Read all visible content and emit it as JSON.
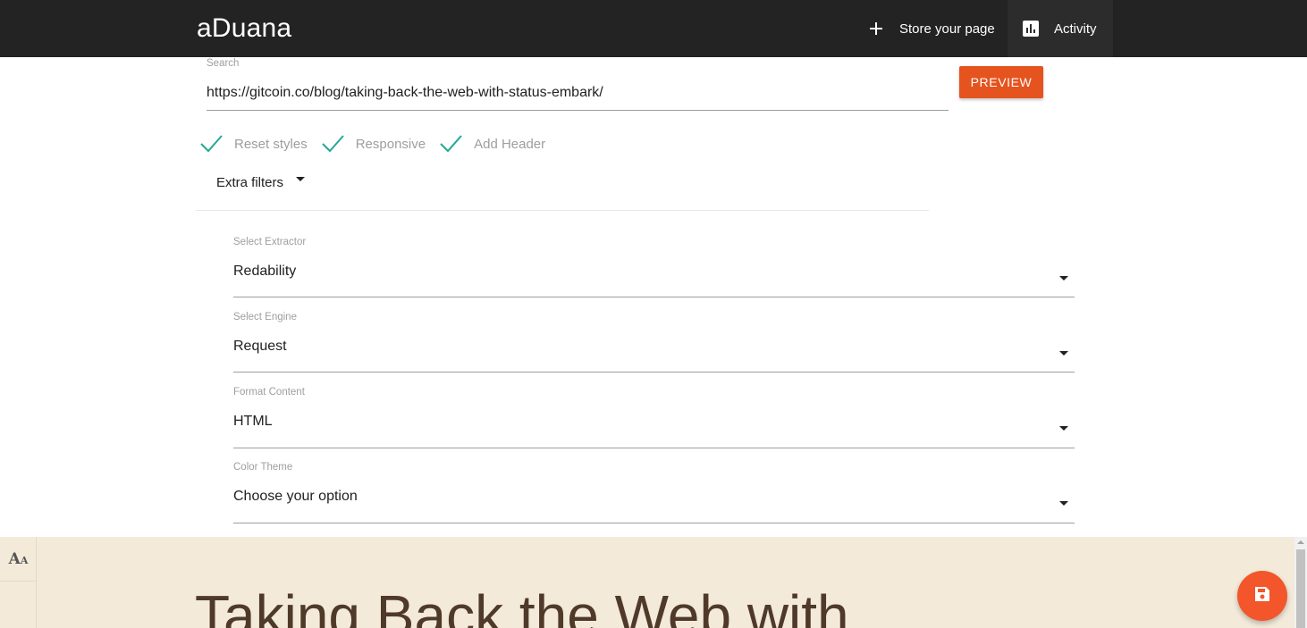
{
  "nav": {
    "brand": "aDuana",
    "store_label": "Store your page",
    "activity_label": "Activity",
    "store_icon": "plus-icon",
    "activity_icon": "bar-chart-icon",
    "background": "#232323"
  },
  "search": {
    "label": "Search",
    "value": "https://gitcoin.co/blog/taking-back-the-web-with-status-embark/",
    "preview_label": "PREVIEW",
    "accent": "#e5531e"
  },
  "options": [
    {
      "label": "Reset styles",
      "checked": true
    },
    {
      "label": "Responsive",
      "checked": true
    },
    {
      "label": "Add Header",
      "checked": true
    }
  ],
  "extra_filters": {
    "label": "Extra filters"
  },
  "selects": [
    {
      "label": "Select Extractor",
      "value": "Redability"
    },
    {
      "label": "Select Engine",
      "value": "Request"
    },
    {
      "label": "Format Content",
      "value": "HTML"
    },
    {
      "label": "Color Theme",
      "value": "Choose your option"
    }
  ],
  "preview": {
    "title": "Taking Back the Web with",
    "font_icon": "font-size-icon",
    "save_icon": "save-icon",
    "background": "#f3eada"
  }
}
